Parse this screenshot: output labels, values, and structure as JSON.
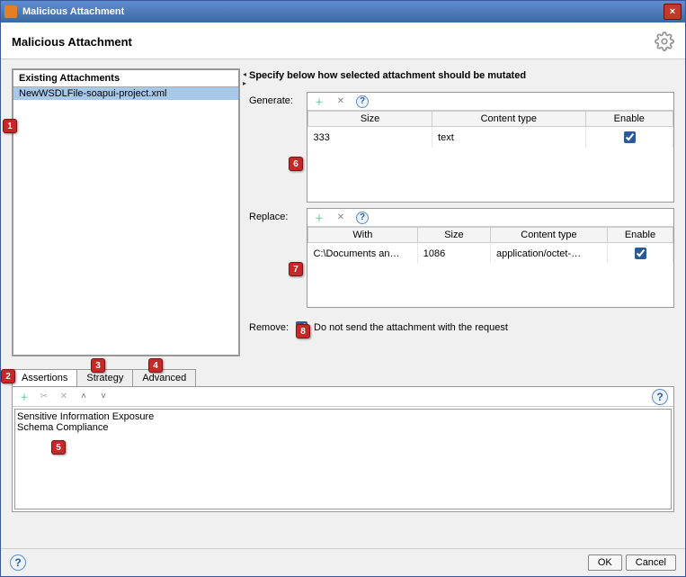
{
  "window": {
    "title": "Malicious Attachment"
  },
  "header": {
    "title": "Malicious Attachment"
  },
  "left": {
    "header": "Existing Attachments",
    "items": [
      "NewWSDLFile-soapui-project.xml"
    ]
  },
  "right": {
    "desc": "Specify below how selected attachment should be mutated",
    "generate": {
      "label": "Generate:",
      "cols": {
        "size": "Size",
        "ctype": "Content type",
        "enable": "Enable"
      },
      "row": {
        "size": "333",
        "ctype": "text",
        "enable": true
      }
    },
    "replace": {
      "label": "Replace:",
      "cols": {
        "with": "With",
        "size": "Size",
        "ctype": "Content type",
        "enable": "Enable"
      },
      "row": {
        "with": "C:\\Documents an…",
        "size": "1086",
        "ctype": "application/octet-…",
        "enable": true
      }
    },
    "remove": {
      "label": "Remove:",
      "checkbox_label": "Do not send the attachment with the request",
      "checked": true
    }
  },
  "tabs": {
    "assertions": "Assertions",
    "strategy": "Strategy",
    "advanced": "Advanced"
  },
  "assertions": {
    "items": [
      "Sensitive Information Exposure",
      "Schema Compliance"
    ]
  },
  "buttons": {
    "ok": "OK",
    "cancel": "Cancel"
  },
  "callouts": {
    "c1": "1",
    "c2": "2",
    "c3": "3",
    "c4": "4",
    "c5": "5",
    "c6": "6",
    "c7": "7",
    "c8": "8"
  }
}
